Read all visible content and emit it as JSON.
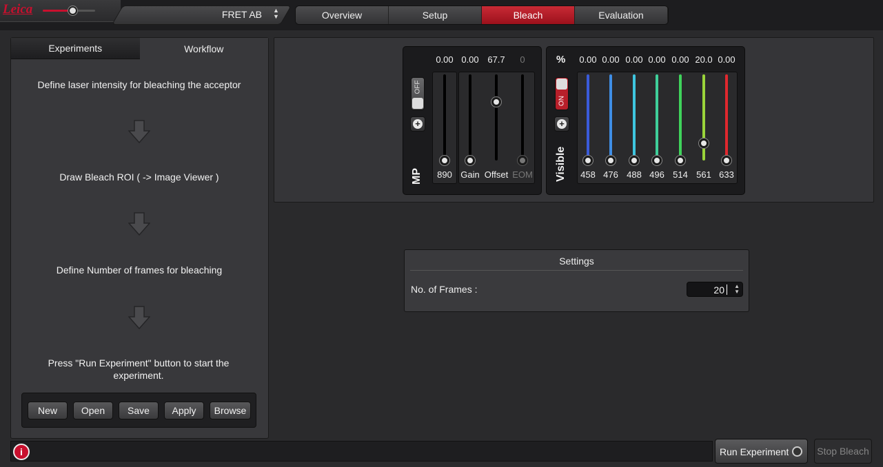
{
  "logo_text": "Leica",
  "config": {
    "selected": "FRET AB"
  },
  "steps": [
    {
      "label": "Overview",
      "active": false
    },
    {
      "label": "Setup",
      "active": false
    },
    {
      "label": "Bleach",
      "active": true
    },
    {
      "label": "Evaluation",
      "active": false
    }
  ],
  "left_panel": {
    "tabs": [
      {
        "label": "Experiments",
        "selected": false
      },
      {
        "label": "Workflow",
        "selected": true
      }
    ],
    "workflow_steps": [
      "Define laser intensity for bleaching the acceptor",
      "Draw Bleach ROI ( -> Image Viewer )",
      "Define Number of frames for bleaching",
      "Press \"Run Experiment\" button to start the experiment."
    ],
    "buttons": [
      "New",
      "Open",
      "Save",
      "Apply",
      "Browse"
    ]
  },
  "mp_panel": {
    "title": "MP",
    "toggle": "OFF",
    "channels": [
      {
        "label": "890",
        "value": "0.00",
        "level": 0.0,
        "enabled": true
      },
      {
        "label": "Gain",
        "value": "0.00",
        "level": 0.0,
        "enabled": true
      },
      {
        "label": "Offset",
        "value": "67.7",
        "level": 0.677,
        "enabled": true
      },
      {
        "label": "EOM",
        "value": "0",
        "level": 0.0,
        "enabled": false
      }
    ]
  },
  "visible_panel": {
    "title": "Visible",
    "unit": "%",
    "toggle": "ON",
    "lasers": [
      {
        "label": "458",
        "value": "0.00",
        "level": 0.0,
        "color": "#3a5bd9"
      },
      {
        "label": "476",
        "value": "0.00",
        "level": 0.0,
        "color": "#3f8ee6"
      },
      {
        "label": "488",
        "value": "0.00",
        "level": 0.0,
        "color": "#3ec6e0"
      },
      {
        "label": "496",
        "value": "0.00",
        "level": 0.0,
        "color": "#3fcf9a"
      },
      {
        "label": "514",
        "value": "0.00",
        "level": 0.0,
        "color": "#3fd35b"
      },
      {
        "label": "561",
        "value": "20.0",
        "level": 0.2,
        "color": "#9ad43a"
      },
      {
        "label": "633",
        "value": "0.00",
        "level": 0.0,
        "color": "#e0282e"
      }
    ]
  },
  "settings": {
    "title": "Settings",
    "frames_label": "No. of Frames :",
    "frames_value": "20"
  },
  "footer": {
    "run_label": "Run Experiment",
    "stop_label": "Stop Bleach"
  }
}
